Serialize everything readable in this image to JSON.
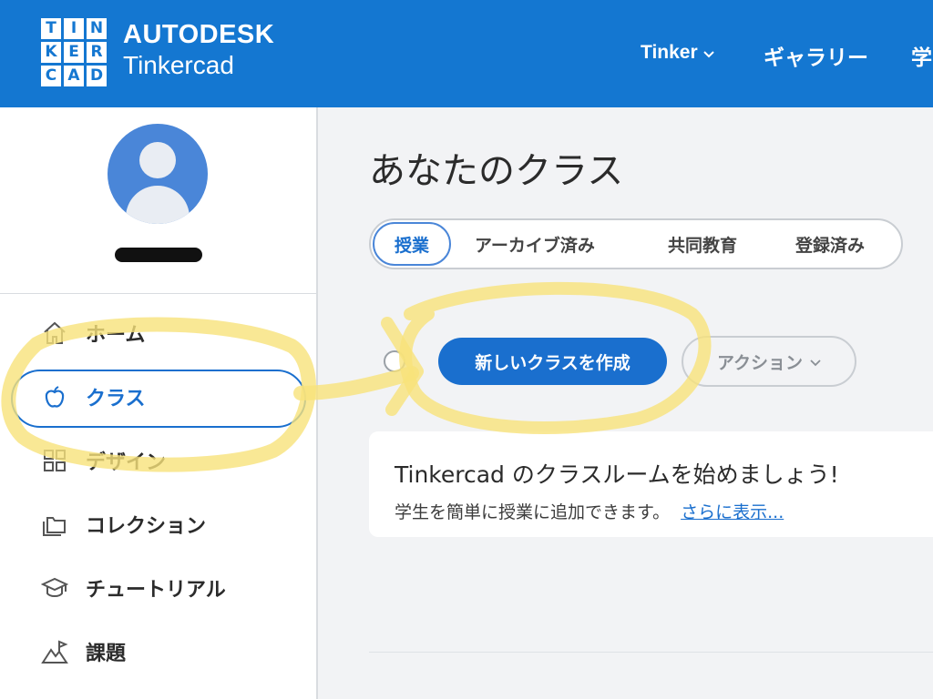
{
  "header": {
    "logo_letters": [
      "T",
      "I",
      "N",
      "K",
      "E",
      "R",
      "C",
      "A",
      "D"
    ],
    "brand": "AUTODESK",
    "product": "Tinkercad",
    "nav": {
      "tinker": "Tinker",
      "gallery": "ギャラリー",
      "learn": "学"
    }
  },
  "sidebar": {
    "items": [
      {
        "label": "ホーム",
        "icon": "home-icon"
      },
      {
        "label": "クラス",
        "icon": "apple-icon"
      },
      {
        "label": "デザイン",
        "icon": "grid-icon"
      },
      {
        "label": "コレクション",
        "icon": "folder-icon"
      },
      {
        "label": "チュートリアル",
        "icon": "graduation-cap-icon"
      },
      {
        "label": "課題",
        "icon": "mountain-flag-icon"
      }
    ],
    "active_index": 1
  },
  "main": {
    "title": "あなたのクラス",
    "tabs": [
      "授業",
      "アーカイブ済み",
      "共同教育",
      "登録済み"
    ],
    "active_tab": 0,
    "primary_button": "新しいクラスを作成",
    "action_button": "アクション",
    "card": {
      "title": "Tinkercad のクラスルームを始めましょう!",
      "text": "学生を簡単に授業に追加できます。",
      "link": "さらに表示..."
    }
  },
  "colors": {
    "header_bg": "#1477d1",
    "accent": "#1a6fce",
    "highlighter": "#f7e27a"
  }
}
